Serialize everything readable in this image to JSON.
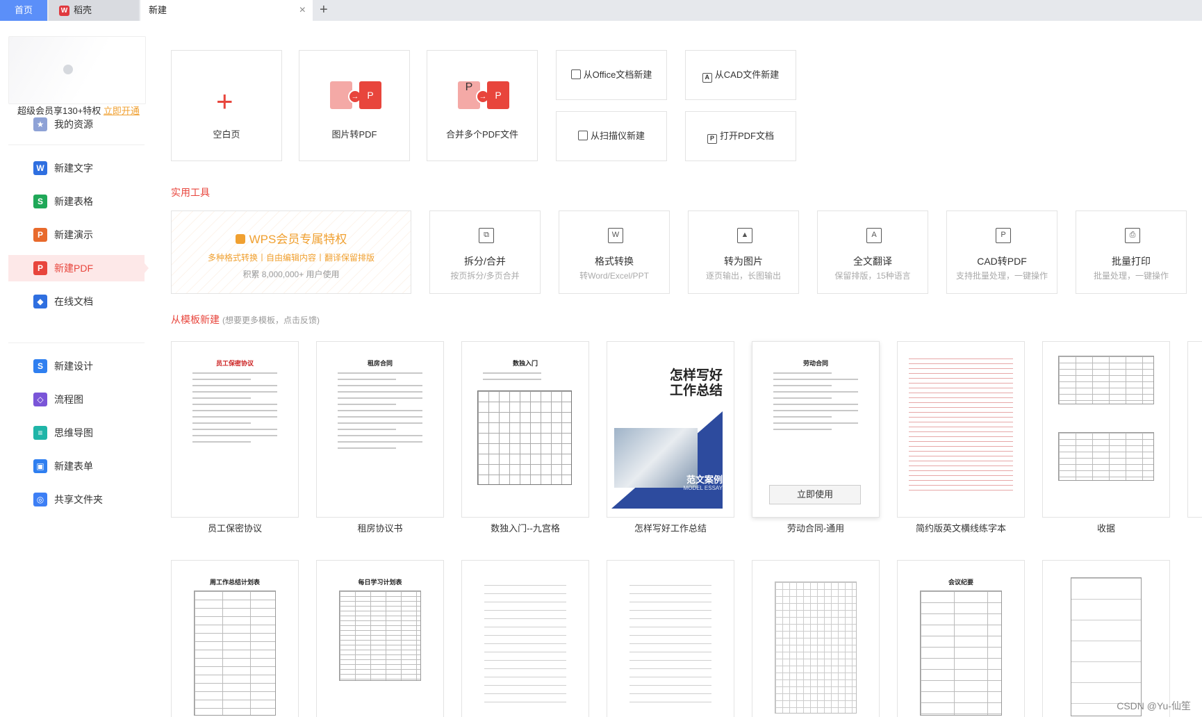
{
  "tabs": {
    "home": "首页",
    "daoke": "稻壳",
    "daoke_icon": "W",
    "new": "新建",
    "close": "×",
    "plus": "+"
  },
  "sidebar": {
    "vip_text": "超级会员享130+特权",
    "vip_link": "立即开通",
    "items": [
      {
        "label": "我的资源",
        "icon": "star-icon",
        "color": "#8ea2d6"
      },
      {
        "label": "新建文字",
        "icon": "W",
        "color": "#2f6fe0"
      },
      {
        "label": "新建表格",
        "icon": "S",
        "color": "#1fa858"
      },
      {
        "label": "新建演示",
        "icon": "P",
        "color": "#e86a2c"
      },
      {
        "label": "新建PDF",
        "icon": "P",
        "color": "#e8453c"
      },
      {
        "label": "在线文档",
        "icon": "◆",
        "color": "#2f6fe0"
      },
      {
        "label": "新建设计",
        "icon": "S",
        "color": "#2f7ff0"
      },
      {
        "label": "流程图",
        "icon": "◇",
        "color": "#7a55d8"
      },
      {
        "label": "思维导图",
        "icon": "≡",
        "color": "#1fb5a8"
      },
      {
        "label": "新建表单",
        "icon": "▣",
        "color": "#2f7ff0"
      },
      {
        "label": "共享文件夹",
        "icon": "◎",
        "color": "#3d7ff5"
      }
    ]
  },
  "create": {
    "blank": "空白页",
    "img2pdf": "图片转PDF",
    "merge": "合并多个PDF文件",
    "plus": "+",
    "from_office": "从Office文档新建",
    "from_cad": "从CAD文件新建",
    "from_scanner": "从扫描仪新建",
    "open_pdf": "打开PDF文档"
  },
  "tools": {
    "section_title": "实用工具",
    "vip_title": "WPS会员专属特权",
    "vip_sub": "多种格式转换丨自由编辑内容丨翻译保留排版",
    "vip_count": "积累 8,000,000+ 用户使用",
    "items": [
      {
        "name": "拆分/合并",
        "desc": "按页拆分/多页合并",
        "icon": "split-merge-icon"
      },
      {
        "name": "格式转换",
        "desc": "转Word/Excel/PPT",
        "icon": "format-convert-icon"
      },
      {
        "name": "转为图片",
        "desc": "逐页输出，长图输出",
        "icon": "to-image-icon"
      },
      {
        "name": "全文翻译",
        "desc": "保留排版，15种语言",
        "icon": "translate-icon"
      },
      {
        "name": "CAD转PDF",
        "desc": "支持批量处理，一键操作",
        "icon": "cad-to-pdf-icon"
      },
      {
        "name": "批量打印",
        "desc": "批量处理，一键操作",
        "icon": "printer-icon"
      }
    ]
  },
  "templates": {
    "section_title": "从模板新建",
    "section_sub": "(想要更多模板，点击反馈)",
    "use_button": "立即使用",
    "items": [
      {
        "label": "员工保密协议",
        "title": "员工保密协议"
      },
      {
        "label": "租房协议书",
        "title": "租房合同"
      },
      {
        "label": "数独入门--九宫格",
        "title": "数独入门"
      },
      {
        "label": "怎样写好工作总结",
        "cover_title_1": "怎样写好",
        "cover_title_2": "工作总结",
        "cover_case": "范文案例",
        "cover_case_en": "MODEL ESSAY"
      },
      {
        "label": "劳动合同-通用",
        "title": "劳动合同"
      },
      {
        "label": "简约版英文横线练字本"
      },
      {
        "label": "收据"
      }
    ],
    "row2_titles": [
      "周工作总结计划表",
      "每日学习计划表",
      "",
      "",
      "",
      "会议纪要",
      ""
    ]
  },
  "watermark": "CSDN @Yu-仙笙"
}
